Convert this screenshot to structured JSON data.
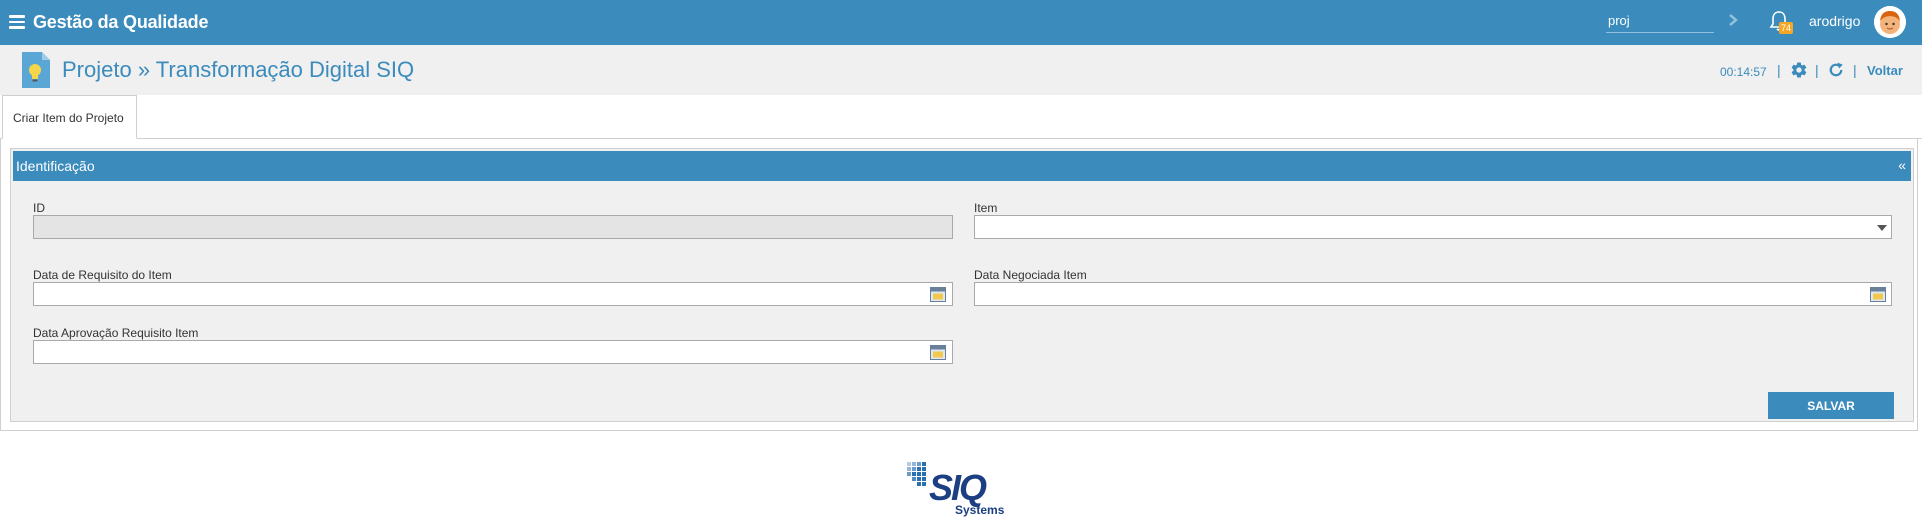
{
  "header": {
    "app_title": "Gestão da Qualidade",
    "search_value": "proj",
    "notification_count": "74",
    "username": "arodrigo",
    "bar_color": "#3b8bbd"
  },
  "subheader": {
    "page_title": "Projeto » Transformação Digital SIQ",
    "timer": "00:14:57",
    "separator": "|",
    "back_label": "Voltar"
  },
  "tabs": [
    {
      "label": "Criar Item do Projeto",
      "active": true
    }
  ],
  "panel": {
    "title": "Identificação",
    "collapse_icon": "«"
  },
  "form": {
    "id_label": "ID",
    "id_value": "",
    "item_label": "Item",
    "item_value": "",
    "req_date_label": "Data de Requisito do Item",
    "req_date_value": "",
    "neg_date_label": "Data Negociada Item",
    "neg_date_value": "",
    "approval_date_label": "Data Aprovação Requisito Item",
    "approval_date_value": "",
    "save_label": "SALVAR"
  },
  "footer": {
    "logo_text": "SIQ",
    "logo_subtext": "Systems"
  },
  "icons": [
    "menu-icon",
    "chevron-right-icon",
    "bell-icon",
    "avatar",
    "lightbulb-page-icon",
    "gear-icon",
    "refresh-icon",
    "calendar-icon",
    "chevron-down-icon"
  ]
}
